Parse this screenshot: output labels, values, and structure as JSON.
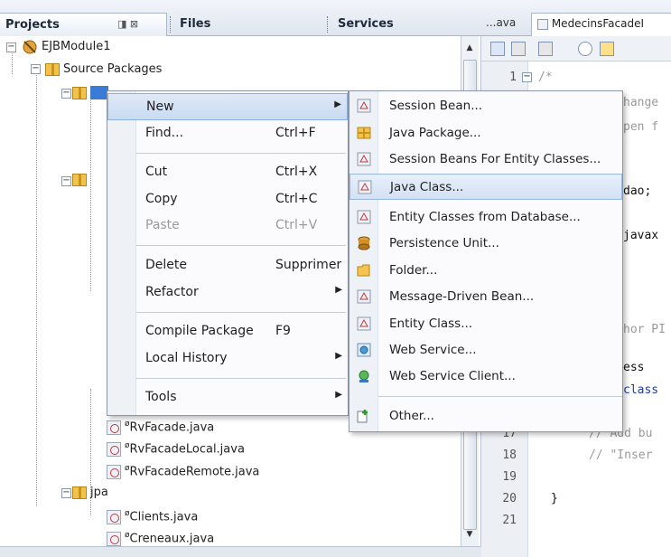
{
  "panel_tabs": {
    "projects": "Projects",
    "files": "Files",
    "services": "Services",
    "projects_controls": "◨ ⊠"
  },
  "tree": {
    "root": "EJBModule1",
    "source_packages": "Source Packages",
    "selected_pkg": "",
    "files": [
      "RvFacade.java",
      "RvFacadeLocal.java",
      "RvFacadeRemote.java"
    ],
    "jpa_pkg": "jpa",
    "jpa_files": [
      "Clients.java",
      "Creneaux.java"
    ]
  },
  "editor": {
    "tab1": "...ava",
    "tab2": "MedecinsFacadeI",
    "line_numbers": [
      "1",
      "17",
      "18",
      "19",
      "20",
      "21"
    ],
    "code_fragments": {
      "l1": "/*",
      "change": "hange",
      "open": "pen f",
      "dao": "dao;",
      "javax": "javax",
      "hor": "hor PI",
      "ess": "ess",
      "class": "class",
      "l17": "// Add bu",
      "l18": "// \"Inser",
      "l20": "}"
    }
  },
  "context_menu": {
    "items": [
      {
        "label": "New",
        "shortcut": "",
        "submenu": true
      },
      {
        "label": "Find...",
        "shortcut": "Ctrl+F"
      },
      {
        "label": "Cut",
        "shortcut": "Ctrl+X"
      },
      {
        "label": "Copy",
        "shortcut": "Ctrl+C"
      },
      {
        "label": "Paste",
        "shortcut": "Ctrl+V",
        "disabled": true
      },
      {
        "label": "Delete",
        "shortcut": "Supprimer"
      },
      {
        "label": "Refactor",
        "shortcut": "",
        "submenu": true
      },
      {
        "label": "Compile Package",
        "shortcut": "F9"
      },
      {
        "label": "Local History",
        "shortcut": "",
        "submenu": true
      },
      {
        "label": "Tools",
        "shortcut": "",
        "submenu": true
      }
    ]
  },
  "submenu_new": {
    "items": [
      {
        "label": "Session Bean...",
        "icon": "bean-icon"
      },
      {
        "label": "Java Package...",
        "icon": "package-icon"
      },
      {
        "label": "Session Beans For Entity Classes...",
        "icon": "bean-icon"
      },
      {
        "label": "Java Class...",
        "icon": "java-class-icon"
      },
      {
        "label": "Entity Classes from Database...",
        "icon": "entity-icon"
      },
      {
        "label": "Persistence Unit...",
        "icon": "persistence-icon"
      },
      {
        "label": "Folder...",
        "icon": "folder-icon"
      },
      {
        "label": "Message-Driven Bean...",
        "icon": "bean-icon"
      },
      {
        "label": "Entity Class...",
        "icon": "entity-icon"
      },
      {
        "label": "Web Service...",
        "icon": "web-service-icon"
      },
      {
        "label": "Web Service Client...",
        "icon": "web-service-client-icon"
      },
      {
        "label": "Other...",
        "icon": "other-icon"
      }
    ],
    "highlighted_index": 3
  }
}
